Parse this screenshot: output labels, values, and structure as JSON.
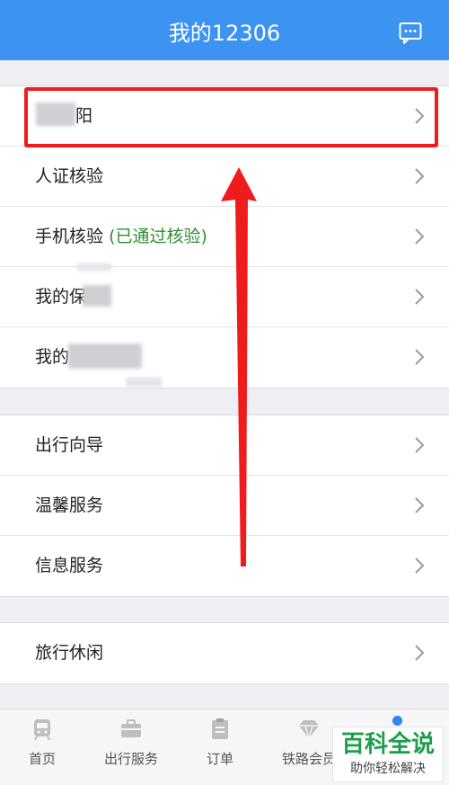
{
  "header": {
    "title": "我的12306",
    "message_icon": "message-icon"
  },
  "account": {
    "name_visible": "阳"
  },
  "group1": {
    "id_verify": "人证核验",
    "phone_verify": "手机核验",
    "phone_verify_status": "(已通过核验)",
    "insurance_prefix": "我的保",
    "item5_prefix": "我的"
  },
  "group2": {
    "travel_guide": "出行向导",
    "warm_service": "温馨服务",
    "info_service": "信息服务"
  },
  "group3": {
    "leisure": "旅行休闲"
  },
  "tabbar": {
    "home": "首页",
    "travel": "出行服务",
    "orders": "订单",
    "member": "铁路会员"
  },
  "watermark": {
    "brand": "百科全说",
    "slogan": "助你轻松解决"
  },
  "colors": {
    "header_bg": "#3d93f0",
    "highlight": "#ee1c1c",
    "verified_text": "#2f8f2f",
    "watermark_green": "#1e9e4b"
  }
}
